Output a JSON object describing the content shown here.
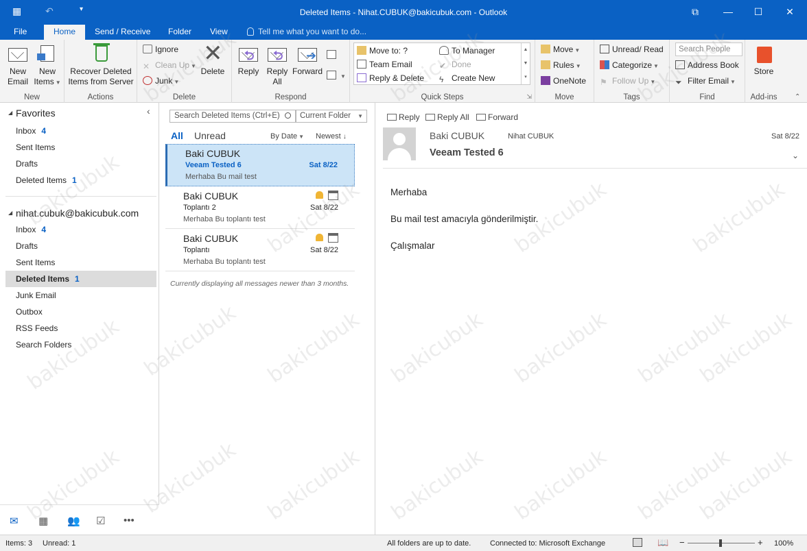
{
  "window": {
    "title": "Deleted Items - Nihat.CUBUK@bakicubuk.com - Outlook",
    "controls": {
      "minimize": "—",
      "maximize": "☐",
      "close": "✕",
      "restore": "⧉"
    }
  },
  "tabs": [
    {
      "label": "File"
    },
    {
      "label": "Home"
    },
    {
      "label": "Send / Receive"
    },
    {
      "label": "Folder"
    },
    {
      "label": "View"
    }
  ],
  "tell_me": "Tell me what you want to do...",
  "ribbon": {
    "new": {
      "new_email": [
        "New",
        "Email"
      ],
      "new_items": [
        "New",
        "Items"
      ],
      "label": "New"
    },
    "actions": {
      "recover": [
        "Recover Deleted",
        "Items from Server"
      ],
      "label": "Actions"
    },
    "delete": {
      "ignore": "Ignore",
      "clean_up": "Clean Up",
      "junk": "Junk",
      "delete": "Delete",
      "label": "Delete"
    },
    "respond": {
      "reply": "Reply",
      "reply_all": [
        "Reply",
        "All"
      ],
      "forward": "Forward",
      "label": "Respond"
    },
    "quick_steps": {
      "items": [
        "Move to: ?",
        "Team Email",
        "Reply & Delete",
        "To Manager",
        "Done",
        "Create New"
      ],
      "label": "Quick Steps"
    },
    "move": {
      "move": "Move",
      "rules": "Rules",
      "onenote": "OneNote",
      "label": "Move"
    },
    "tags": {
      "unread_read": "Unread/ Read",
      "categorize": "Categorize",
      "follow_up": "Follow Up",
      "label": "Tags"
    },
    "find": {
      "search_people_placeholder": "Search People",
      "address_book": "Address Book",
      "filter_email": "Filter Email",
      "label": "Find"
    },
    "addins": {
      "store": "Store",
      "label": "Add-ins"
    }
  },
  "folders": {
    "favorites_title": "Favorites",
    "favorites": [
      {
        "name": "Inbox",
        "count": "4"
      },
      {
        "name": "Sent Items",
        "count": ""
      },
      {
        "name": "Drafts",
        "count": ""
      },
      {
        "name": "Deleted Items",
        "count": "1"
      }
    ],
    "account": "nihat.cubuk@bakicubuk.com",
    "account_folders": [
      {
        "name": "Inbox",
        "count": "4"
      },
      {
        "name": "Drafts",
        "count": ""
      },
      {
        "name": "Sent Items",
        "count": ""
      },
      {
        "name": "Deleted Items",
        "count": "1"
      },
      {
        "name": "Junk Email",
        "count": ""
      },
      {
        "name": "Outbox",
        "count": ""
      },
      {
        "name": "RSS Feeds",
        "count": ""
      },
      {
        "name": "Search Folders",
        "count": ""
      }
    ]
  },
  "message_list": {
    "search_placeholder": "Search Deleted Items (Ctrl+E)",
    "scope": "Current Folder",
    "filter_all": "All",
    "filter_unread": "Unread",
    "sort_by": "By Date",
    "sort_order": "Newest",
    "messages": [
      {
        "from": "Baki CUBUK",
        "subject": "Veeam Tested 6",
        "date": "Sat 8/22",
        "preview": "Merhaba  Bu mail test"
      },
      {
        "from": "Baki CUBUK",
        "subject": "Toplantı 2",
        "date": "Sat 8/22",
        "preview": "Merhaba  Bu toplantı test"
      },
      {
        "from": "Baki CUBUK",
        "subject": "Toplantı",
        "date": "Sat 8/22",
        "preview": "Merhaba  Bu toplantı test"
      }
    ],
    "note": "Currently displaying all messages newer than 3 months."
  },
  "reading": {
    "actions": {
      "reply": "Reply",
      "reply_all": "Reply All",
      "forward": "Forward"
    },
    "sender": "Baki CUBUK",
    "recipient": "Nihat CUBUK",
    "date": "Sat 8/22",
    "subject": "Veeam Tested 6",
    "body": [
      "Merhaba",
      "Bu mail test amacıyla gönderilmiştir.",
      "Çalışmalar"
    ]
  },
  "status": {
    "items": "Items: 3",
    "unread": "Unread: 1",
    "sync": "All folders are up to date.",
    "connection": "Connected to: Microsoft Exchange",
    "zoom": "100%",
    "zoom_minus": "−",
    "zoom_plus": "+"
  },
  "watermark": "bakicubuk"
}
